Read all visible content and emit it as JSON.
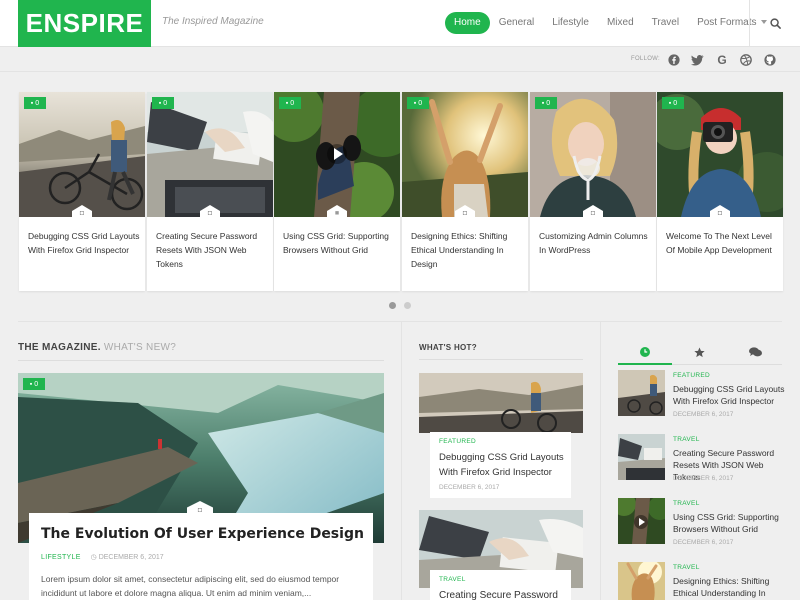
{
  "brand": {
    "logo": "ENSPIRE",
    "tagline": "The Inspired Magazine",
    "accent": "#20b54e"
  },
  "nav": {
    "items": [
      {
        "label": "Home",
        "active": true
      },
      {
        "label": "General"
      },
      {
        "label": "Lifestyle"
      },
      {
        "label": "Mixed"
      },
      {
        "label": "Travel"
      },
      {
        "label": "Post Formats"
      }
    ],
    "search_icon": "search-icon"
  },
  "follow": {
    "label": "FOLLOW:",
    "icons": [
      "facebook-icon",
      "twitter-icon",
      "google-icon",
      "dribbble-icon",
      "github-icon"
    ]
  },
  "slider": {
    "items": [
      {
        "comments": "0",
        "title": "Debugging CSS Grid Layouts With Firefox Grid Inspector",
        "format_icon": "camera-icon"
      },
      {
        "comments": "0",
        "title": "Creating Secure Password Resets With JSON Web Tokens",
        "format_icon": "camera-icon"
      },
      {
        "comments": "0",
        "title": "Using CSS Grid: Supporting Browsers Without Grid",
        "format_icon": "video-icon"
      },
      {
        "comments": "0",
        "title": "Designing Ethics: Shifting Ethical Understanding In Design",
        "format_icon": "camera-icon"
      },
      {
        "comments": "0",
        "title": "Customizing Admin Columns In WordPress",
        "format_icon": "camera-icon"
      },
      {
        "comments": "0",
        "title": "Welcome To The Next Level Of Mobile App Development",
        "format_icon": "camera-icon"
      }
    ]
  },
  "magazine": {
    "heading": "THE MAGAZINE.",
    "subheading": "WHAT'S NEW?",
    "featured": {
      "comments": "0",
      "title": "The Evolution Of User Experience Design",
      "category": "LIFESTYLE",
      "date": "DECEMBER 6, 2017",
      "excerpt": "Lorem ipsum dolor sit amet, consectetur adipiscing elit, sed do eiusmod tempor incididunt ut labore et dolore magna aliqua. Ut enim ad minim veniam,..."
    }
  },
  "hot": {
    "heading": "WHAT'S HOT?",
    "items": [
      {
        "category": "FEATURED",
        "title": "Debugging CSS Grid Layouts With Firefox Grid Inspector",
        "date": "DECEMBER 6, 2017"
      },
      {
        "category": "TRAVEL",
        "title": "Creating Secure Password"
      }
    ]
  },
  "sidebar": {
    "tabs": [
      "clock-icon",
      "star-icon",
      "comments-icon"
    ],
    "items": [
      {
        "category": "FEATURED",
        "title": "Debugging CSS Grid Layouts With Firefox Grid Inspector",
        "date": "DECEMBER 6, 2017"
      },
      {
        "category": "TRAVEL",
        "title": "Creating Secure Password Resets With JSON Web Tokens",
        "date": "DECEMBER 6, 2017"
      },
      {
        "category": "TRAVEL",
        "title": "Using CSS Grid: Supporting Browsers Without Grid",
        "date": "DECEMBER 6, 2017"
      },
      {
        "category": "TRAVEL",
        "title": "Designing Ethics: Shifting Ethical Understanding In Design"
      }
    ]
  }
}
